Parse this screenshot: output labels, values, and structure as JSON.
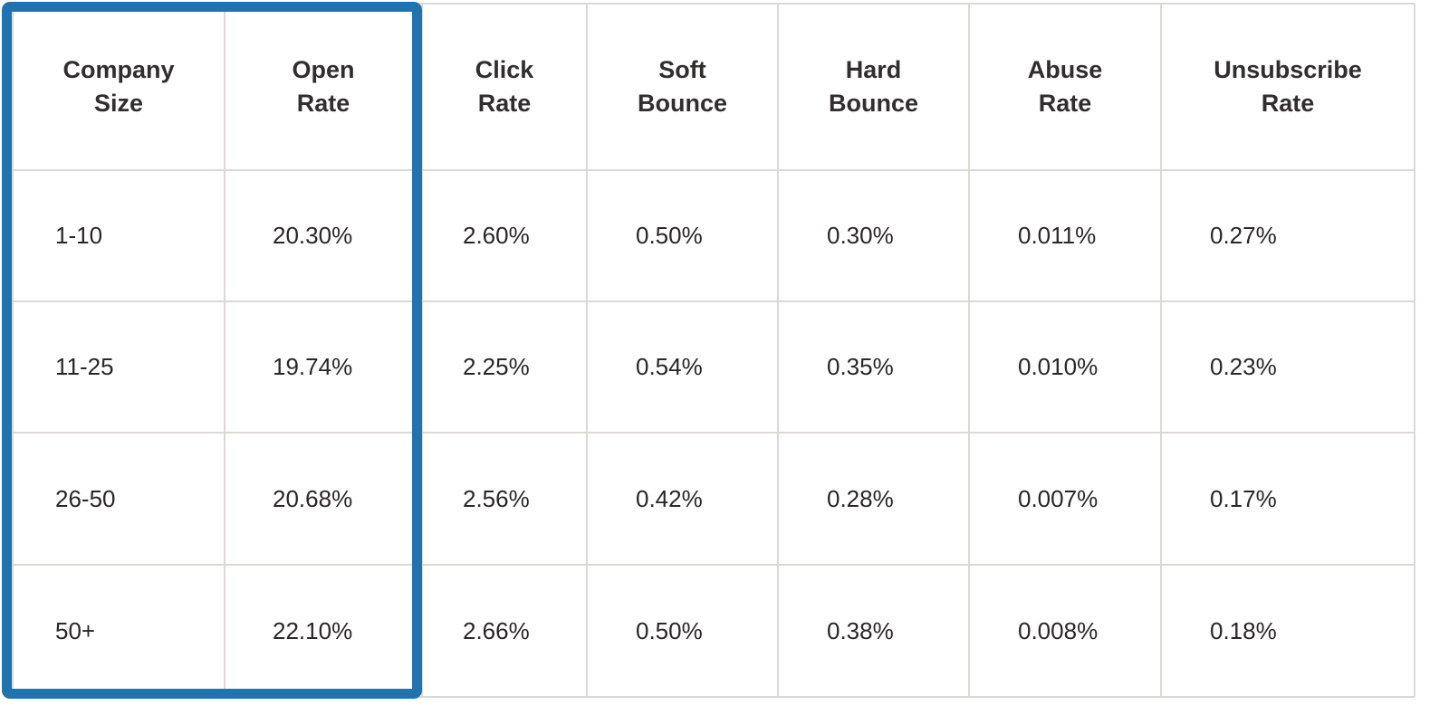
{
  "table": {
    "headers": [
      "Company\nSize",
      "Open\nRate",
      "Click\nRate",
      "Soft\nBounce",
      "Hard\nBounce",
      "Abuse\nRate",
      "Unsubscribe\nRate"
    ],
    "rows": [
      [
        "1-10",
        "20.30%",
        "2.60%",
        "0.50%",
        "0.30%",
        "0.011%",
        "0.27%"
      ],
      [
        "11-25",
        "19.74%",
        "2.25%",
        "0.54%",
        "0.35%",
        "0.010%",
        "0.23%"
      ],
      [
        "26-50",
        "20.68%",
        "2.56%",
        "0.42%",
        "0.28%",
        "0.007%",
        "0.17%"
      ],
      [
        "50+",
        "22.10%",
        "2.66%",
        "0.50%",
        "0.38%",
        "0.008%",
        "0.18%"
      ]
    ],
    "highlighted_columns": [
      "Company Size",
      "Open Rate"
    ]
  },
  "colors": {
    "highlight_border": "#2173b0",
    "grid_line": "#dcd9d5",
    "text": "#2b2626"
  }
}
